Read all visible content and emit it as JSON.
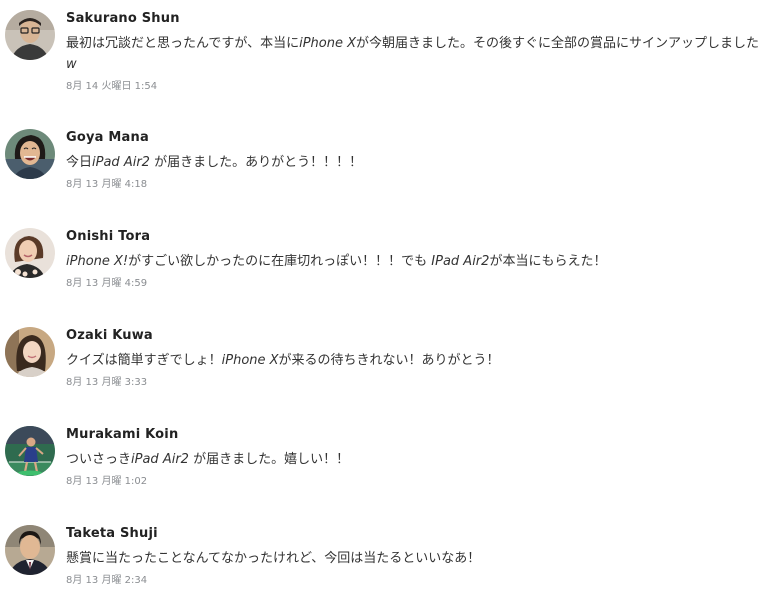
{
  "comments": [
    {
      "name": "Sakurano Shun",
      "text_parts": [
        "最初は冗談だと思ったんですが、本当に",
        "iPhone X",
        "が今朝届きました。その後すぐに全部の賞品にサインアップしました",
        "w"
      ],
      "time": "8月 14 火曜日 1:54",
      "avatar_desc": "man-with-glasses"
    },
    {
      "name": "Goya Mana",
      "text_parts": [
        "今日",
        "iPad Air2",
        " が届きました。ありがとう！！！！"
      ],
      "time": "8月 13 月曜 4:18",
      "avatar_desc": "laughing-woman"
    },
    {
      "name": "Onishi Tora",
      "text_parts": [
        "iPhone X!",
        "がすごい欲しかったのに在庫切れっぽい！！！でも ",
        "IPad Air2",
        "が本当にもらえた！"
      ],
      "time": "8月 13 月曜 4:59",
      "avatar_desc": "woman-photo"
    },
    {
      "name": "Ozaki Kuwa",
      "text_parts": [
        "クイズは簡単すぎでしょ！",
        "iPhone X",
        "が来るの待ちきれない！ありがとう！"
      ],
      "time": "8月 13 月曜 3:33",
      "avatar_desc": "woman-indoor"
    },
    {
      "name": "Murakami Koin",
      "text_parts": [
        "ついさっき",
        "iPad Air2",
        " が届きました。嬉しい！！"
      ],
      "time": "8月 13 月曜 1:02",
      "avatar_desc": "tennis-player"
    },
    {
      "name": "Taketa Shuji",
      "text_parts": [
        "懸賞に当たったことなんてなかったけれど、今回は当たるといいなあ！"
      ],
      "time": "8月 13 月曜 2:34",
      "avatar_desc": "man-in-suit"
    }
  ]
}
